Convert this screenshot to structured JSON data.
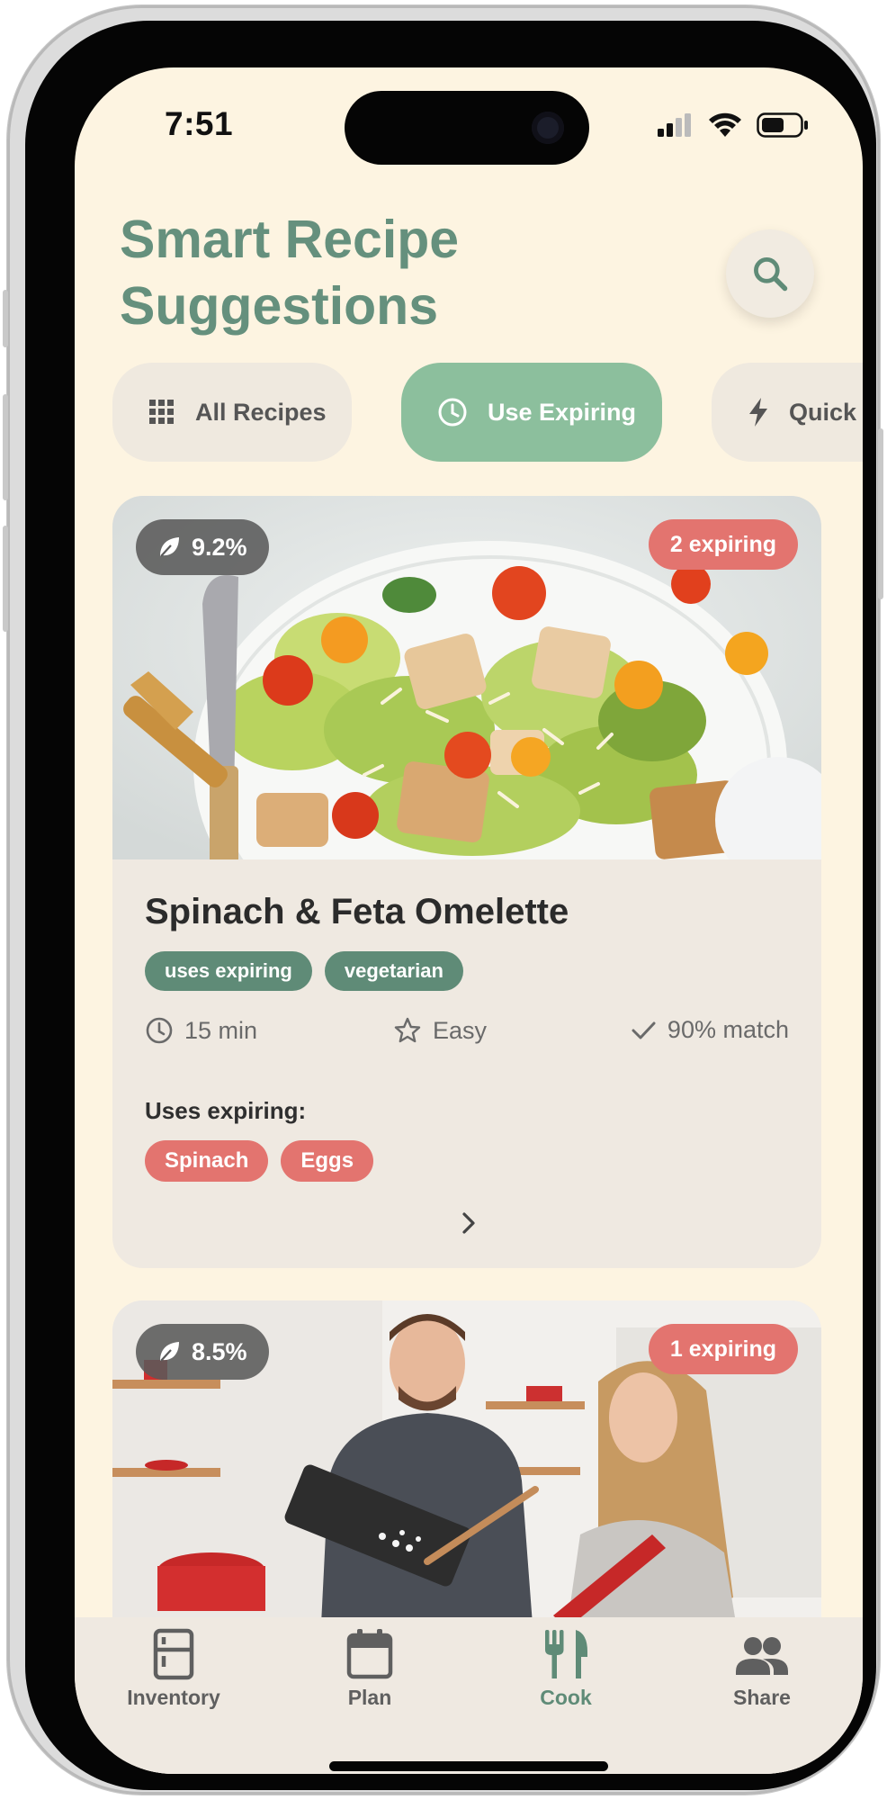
{
  "status_bar": {
    "time": "7:51"
  },
  "header": {
    "title": "Smart Recipe Suggestions",
    "search_icon": "search-icon"
  },
  "filters": [
    {
      "label": "All Recipes",
      "icon": "grid-icon",
      "selected": false
    },
    {
      "label": "Use Expiring",
      "icon": "clock-icon",
      "selected": true
    },
    {
      "label": "Quick",
      "icon": "bolt-icon",
      "selected": false
    }
  ],
  "recipes": [
    {
      "eco_score": "9.2%",
      "expiring_badge": "2 expiring",
      "title": "Spinach & Feta Omelette",
      "tags": [
        "uses expiring",
        "vegetarian"
      ],
      "time": "15 min",
      "difficulty": "Easy",
      "match": "90% match",
      "uses_expiring_label": "Uses expiring:",
      "expiring_ingredients": [
        "Spinach",
        "Eggs"
      ]
    },
    {
      "eco_score": "8.5%",
      "expiring_badge": "1 expiring"
    }
  ],
  "bottom_nav": [
    {
      "label": "Inventory",
      "icon": "fridge-icon",
      "active": false
    },
    {
      "label": "Plan",
      "icon": "calendar-icon",
      "active": false
    },
    {
      "label": "Cook",
      "icon": "utensils-icon",
      "active": true
    },
    {
      "label": "Share",
      "icon": "people-icon",
      "active": false
    }
  ],
  "colors": {
    "background": "#fdf4e1",
    "accent_green": "#65907d",
    "chip_selected": "#8cbf9d",
    "expiring_red": "#e3746f",
    "tag_green": "#5f8b77",
    "card_bg": "#efe9e1"
  }
}
